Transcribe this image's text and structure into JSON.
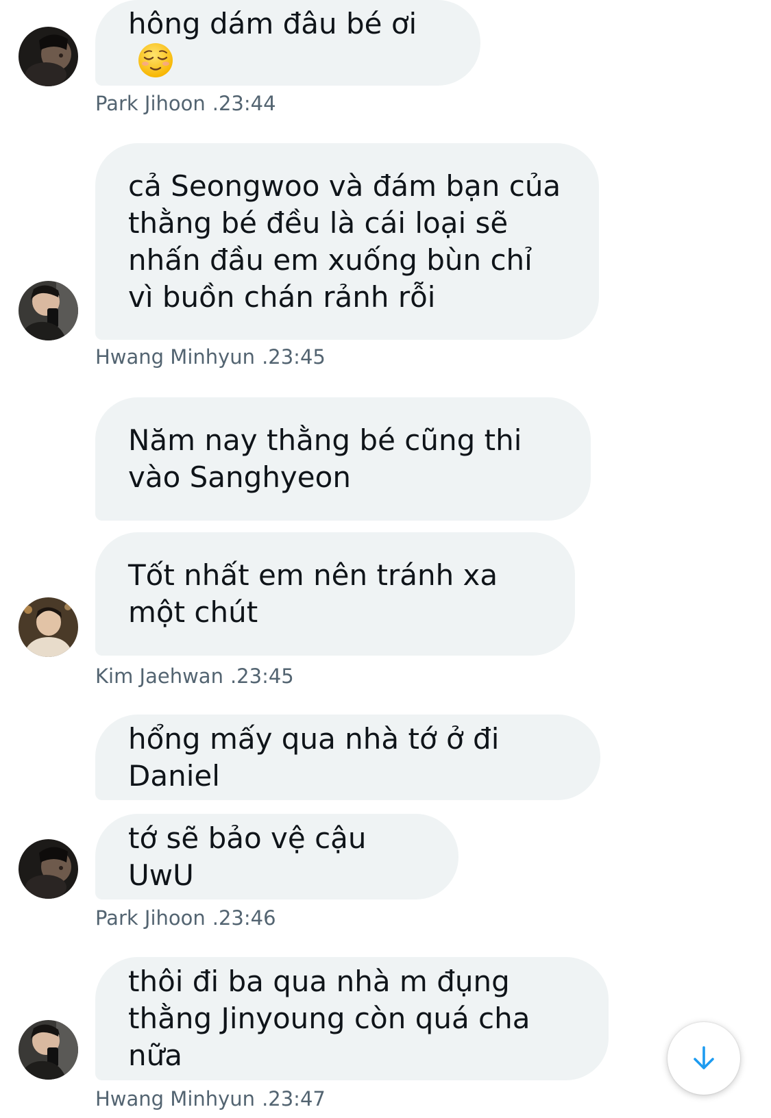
{
  "theme": {
    "bubble_color": "#eff3f4",
    "text_color": "#0f1419",
    "meta_color": "#536471",
    "accent": "#1d9bf0"
  },
  "messages": [
    {
      "text": "hông dám đâu bé ơi",
      "emoji": "relieved-face"
    },
    {
      "text": "cả Seongwoo và đám bạn của thằng bé đều là cái loại sẽ nhấn đầu em xuống bùn chỉ vì buồn chán rảnh rỗi"
    },
    {
      "text": "Năm nay thằng bé cũng thi vào Sanghyeon"
    },
    {
      "text": "Tốt nhất em nên tránh xa một chút"
    },
    {
      "text": "hổng mấy qua nhà tớ ở đi Daniel"
    },
    {
      "text": "tớ sẽ bảo vệ cậu UwU"
    },
    {
      "text": "thôi đi ba qua nhà m đụng thằng Jinyoung còn quá cha nữa"
    }
  ],
  "meta": [
    {
      "sender": "Park Jihoon",
      "time": ".23:44"
    },
    {
      "sender": "Hwang Minhyun",
      "time": ".23:45"
    },
    {
      "sender": "Kim Jaehwan",
      "time": ".23:45"
    },
    {
      "sender": "Park Jihoon",
      "time": ".23:46"
    },
    {
      "sender": "Hwang Minhyun",
      "time": ".23:47"
    }
  ],
  "scroll_button": {
    "icon": "arrow-down-icon"
  }
}
